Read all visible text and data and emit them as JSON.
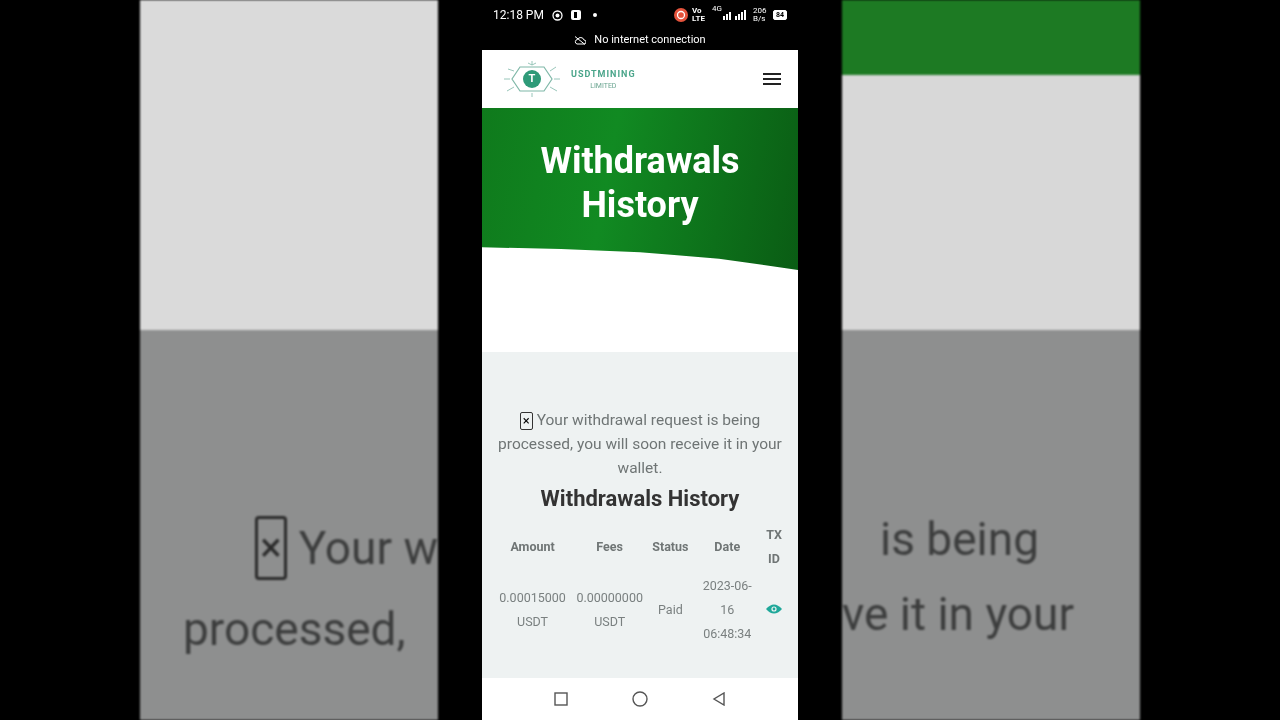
{
  "status_bar": {
    "time": "12:18 PM",
    "network": "Vo LTE",
    "data_type": "4G",
    "speed": "206 B/s",
    "battery": "84"
  },
  "connection_banner": "No internet connection",
  "header": {
    "logo_letter": "T",
    "logo_name": "USDTMINING",
    "logo_sub": "LIMITED"
  },
  "hero": {
    "title": "Withdrawals History"
  },
  "alert": {
    "close": "×",
    "message": "Your withdrawal request is being processed, you will soon receive it in your wallet."
  },
  "section_title": "Withdrawals History",
  "table": {
    "columns": [
      "Amount",
      "Fees",
      "Status",
      "Date",
      "TX ID"
    ],
    "rows": [
      {
        "amount": "0.00015000 USDT",
        "fees": "0.00000000 USDT",
        "status": "Paid",
        "date": "2023-06-16 06:48:34"
      }
    ]
  },
  "backdrop": {
    "left": {
      "close": "×",
      "line_1": "Your w",
      "line_2": "processed,"
    },
    "right": {
      "line_1": "is being",
      "line_2": "ve it in your"
    }
  }
}
